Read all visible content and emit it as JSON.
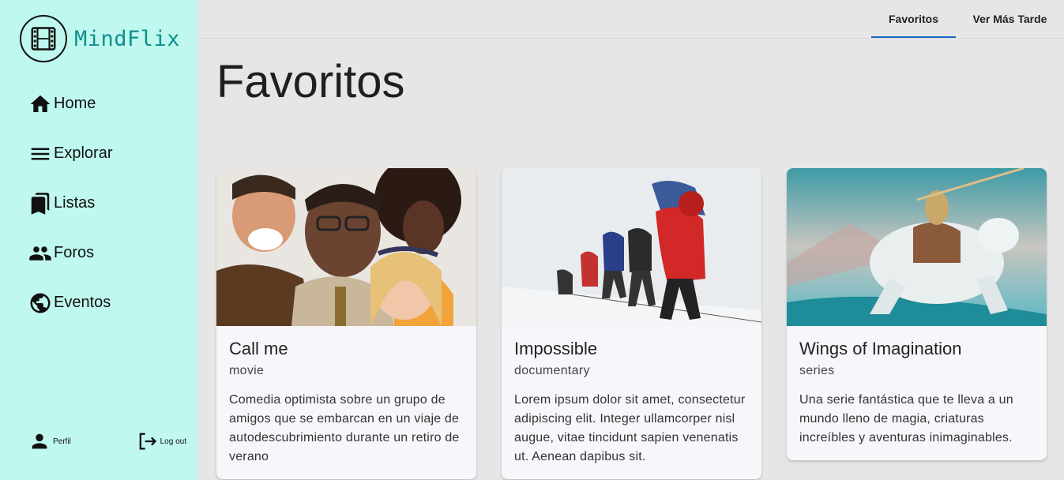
{
  "app": {
    "name": "MindFlix"
  },
  "sidebar": {
    "items": [
      {
        "label": "Home",
        "icon": "home-icon"
      },
      {
        "label": "Explorar",
        "icon": "menu-icon"
      },
      {
        "label": "Listas",
        "icon": "bookmarks-icon"
      },
      {
        "label": "Foros",
        "icon": "people-icon"
      },
      {
        "label": "Eventos",
        "icon": "globe-icon"
      }
    ],
    "profile_label": "Perfil",
    "logout_label": "Log out"
  },
  "tabs": [
    {
      "label": "Favoritos",
      "active": true
    },
    {
      "label": "Ver Más Tarde",
      "active": false
    }
  ],
  "page": {
    "title": "Favoritos"
  },
  "cards": [
    {
      "title": "Call me",
      "type": "movie",
      "description": "Comedia optimista sobre un grupo de amigos que se embarcan en un viaje de autodescubrimiento durante un retiro de verano"
    },
    {
      "title": "Impossible",
      "type": "documentary",
      "description": "Lorem ipsum dolor sit amet, consectetur adipiscing elit. Integer ullamcorper nisl augue, vitae tincidunt sapien venenatis ut. Aenean dapibus sit."
    },
    {
      "title": "Wings of Imagination",
      "type": "series",
      "description": "Una serie fantástica que te lleva a un mundo lleno de magia, criaturas increíbles y aventuras inimaginables."
    }
  ],
  "colors": {
    "sidebar_bg": "#bff8ee",
    "logo_text": "#0f8f8f",
    "tab_indicator": "#1565c0",
    "page_bg": "#e6e6e6",
    "card_bg": "#f7f6fb"
  }
}
